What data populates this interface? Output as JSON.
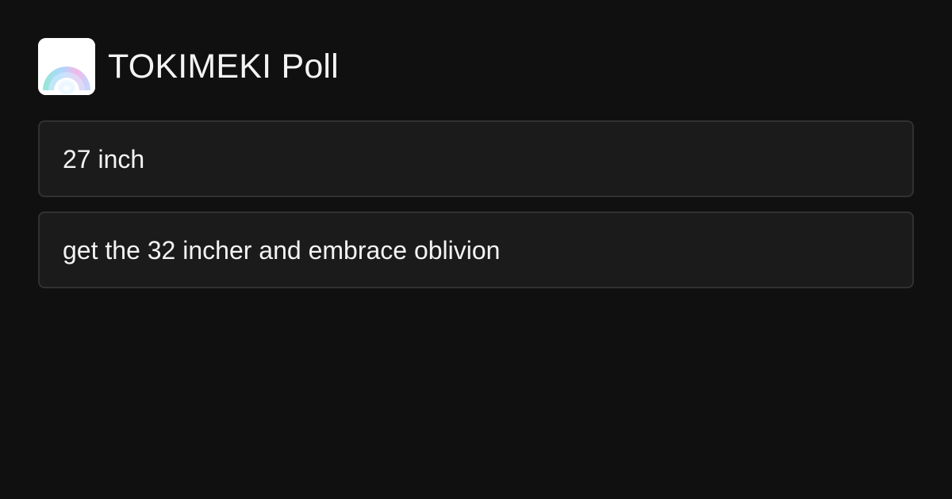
{
  "app": {
    "title": "TOKIMEKI Poll",
    "icon": "tokimeki-rainbow-icon",
    "icon_colors": {
      "background": "#ffffff",
      "rainbow_stops": [
        "#8fe6d2",
        "#a8d6ff",
        "#f3b4e6",
        "#b8d9ff"
      ]
    }
  },
  "poll": {
    "options": [
      {
        "label": "27 inch"
      },
      {
        "label": "get the 32 incher and embrace oblivion"
      }
    ]
  },
  "colors": {
    "background": "#101010",
    "option_background": "#1b1b1b",
    "option_border": "#313131",
    "text": "#f3f3f3"
  }
}
